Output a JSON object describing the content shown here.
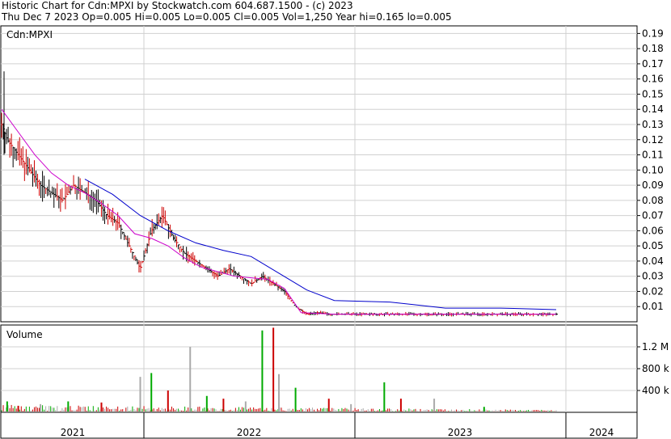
{
  "header": {
    "line1": "Historic Chart for Cdn:MPXI by Stockwatch.com 604.687.1500 - (c) 2023",
    "line2": "Thu Dec  7 2023  Op=0.005  Hi=0.005  Lo=0.005  Cl=0.005  Vol=1,250  Year hi=0.165  lo=0.005"
  },
  "chart_data": [
    {
      "type": "line",
      "panel": "price",
      "title": "Cdn:MPXI",
      "ylim": [
        0,
        0.195
      ],
      "yticks": [
        "0.19",
        "0.18",
        "0.17",
        "0.16",
        "0.15",
        "0.14",
        "0.13",
        "0.12",
        "0.11",
        "0.10",
        "0.09",
        "0.08",
        "0.07",
        "0.06",
        "0.05",
        "0.04",
        "0.03",
        "0.02",
        "0.01"
      ],
      "x_labels": [
        "2021",
        "2022",
        "2023",
        "2024"
      ],
      "grid": true,
      "colors": {
        "up": "#000000",
        "down": "#cc0000",
        "ma_short": "#cc00cc",
        "ma_long": "#0000cc"
      },
      "series": [
        {
          "name": "",
          "kind": "close",
          "x": [
            0,
            0.01,
            0.03,
            0.05,
            0.07,
            0.09,
            0.11,
            0.13,
            0.15,
            0.17,
            0.19,
            0.21,
            0.23,
            0.25,
            0.27,
            0.29,
            0.31,
            0.33,
            0.35,
            0.37,
            0.39,
            0.41,
            0.43,
            0.45,
            0.47,
            0.49,
            0.51,
            0.53,
            0.55,
            0.57,
            0.59,
            0.61,
            0.63,
            0.65,
            0.67,
            0.69,
            0.71,
            0.73,
            0.75,
            0.77,
            0.79,
            0.81,
            0.83,
            0.85,
            0.87,
            0.89,
            0.91,
            0.93,
            0.95,
            0.97,
            1.0
          ],
          "values": [
            0.13,
            0.12,
            0.11,
            0.1,
            0.09,
            0.085,
            0.08,
            0.09,
            0.085,
            0.08,
            0.07,
            0.065,
            0.05,
            0.035,
            0.06,
            0.07,
            0.055,
            0.045,
            0.04,
            0.035,
            0.03,
            0.035,
            0.03,
            0.025,
            0.03,
            0.025,
            0.02,
            0.01,
            0.005,
            0.006,
            0.005,
            0.005,
            0.005,
            0.005,
            0.005,
            0.005,
            0.005,
            0.005,
            0.005,
            0.005,
            0.005,
            0.005,
            0.005,
            0.005,
            0.005,
            0.005,
            0.005,
            0.005,
            0.005,
            0.005,
            0.005
          ]
        },
        {
          "name": "",
          "kind": "ma_short",
          "x": [
            0,
            0.03,
            0.06,
            0.09,
            0.12,
            0.15,
            0.18,
            0.21,
            0.24,
            0.27,
            0.3,
            0.33,
            0.36,
            0.39,
            0.42,
            0.45,
            0.48,
            0.51,
            0.54,
            0.6,
            0.7,
            0.8,
            0.9,
            1.0
          ],
          "values": [
            0.14,
            0.125,
            0.11,
            0.098,
            0.09,
            0.085,
            0.078,
            0.07,
            0.058,
            0.055,
            0.05,
            0.042,
            0.036,
            0.033,
            0.03,
            0.029,
            0.028,
            0.022,
            0.006,
            0.005,
            0.005,
            0.005,
            0.005,
            0.005
          ]
        },
        {
          "name": "",
          "kind": "ma_long",
          "x": [
            0.15,
            0.2,
            0.25,
            0.3,
            0.35,
            0.4,
            0.45,
            0.5,
            0.55,
            0.6,
            0.7,
            0.8,
            0.9,
            1.0
          ],
          "values": [
            0.094,
            0.084,
            0.07,
            0.06,
            0.052,
            0.047,
            0.043,
            0.032,
            0.021,
            0.014,
            0.013,
            0.009,
            0.009,
            0.008
          ]
        }
      ]
    },
    {
      "type": "bar",
      "panel": "volume",
      "title": "Volume",
      "ylim": [
        0,
        1.6
      ],
      "yticks": [
        "1.2 M",
        "800 k",
        "400 k"
      ],
      "series": [
        {
          "name": "",
          "x": [
            0.01,
            0.03,
            0.07,
            0.12,
            0.18,
            0.25,
            0.27,
            0.3,
            0.34,
            0.37,
            0.4,
            0.44,
            0.47,
            0.49,
            0.5,
            0.53,
            0.59,
            0.63,
            0.69,
            0.72,
            0.78,
            0.87
          ],
          "values": [
            0.2,
            0.12,
            0.15,
            0.2,
            0.18,
            0.65,
            0.72,
            0.4,
            1.2,
            0.3,
            0.25,
            0.2,
            1.5,
            1.55,
            0.7,
            0.45,
            0.25,
            0.15,
            0.55,
            0.25,
            0.25,
            0.1
          ]
        }
      ]
    }
  ]
}
